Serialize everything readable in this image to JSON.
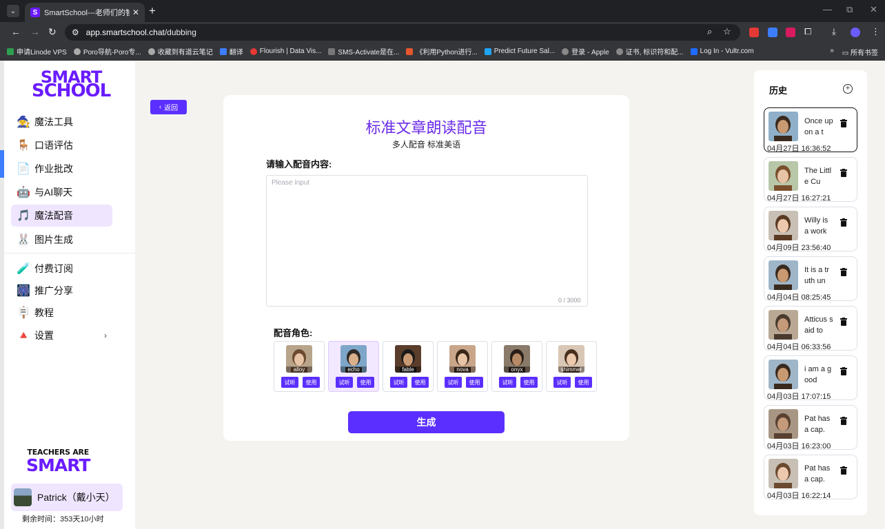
{
  "browser": {
    "tab_title": "SmartSchool---老师们的智能AI",
    "url_domain": "app.smartschool.chat",
    "url_path": "/dubbing",
    "bookmarks": [
      "申请Linode VPS",
      "Poro导航-Poro专...",
      "收藏到有道云笔记",
      "翻译",
      "Flourish | Data Vis...",
      "SMS-Activate是在...",
      "《利用Python进行...",
      "Predict Future Sal...",
      "登录 - Apple",
      "证书, 标识符和配...",
      "Log In - Vultr.com"
    ],
    "all_bookmarks": "所有书签"
  },
  "sidebar": {
    "logo_line1": "SMART",
    "logo_line2": "SCHOOL",
    "items": [
      {
        "label": "魔法工具",
        "icon": "🧙"
      },
      {
        "label": "口语评估",
        "icon": "🪑"
      },
      {
        "label": "作业批改",
        "icon": "📄"
      },
      {
        "label": "与AI聊天",
        "icon": "🤖"
      },
      {
        "label": "魔法配音",
        "icon": "🎵"
      },
      {
        "label": "图片生成",
        "icon": "🐰"
      },
      {
        "label": "付费订阅",
        "icon": "🧪"
      },
      {
        "label": "推广分享",
        "icon": "🎆"
      },
      {
        "label": "教程",
        "icon": "🪧"
      },
      {
        "label": "设置",
        "icon": "🔺"
      }
    ],
    "teachers_line1": "TEACHERS ARE",
    "teachers_line2": "SMART",
    "user_name": "Patrick（戴小天）",
    "remaining": "剩余时间：353天10小时"
  },
  "main": {
    "back_label": "返回",
    "title": "标准文章朗读配音",
    "subtitle": "多人配音 标准美语",
    "input_label": "请输入配音内容:",
    "input_placeholder": "Please input",
    "input_value": "",
    "counter": "0 / 3000",
    "role_label": "配音角色:",
    "listen_label": "试听",
    "use_label": "使用",
    "voices": [
      "alloy",
      "echo",
      "fable",
      "nova",
      "onyx",
      "shimmer"
    ],
    "generate_label": "生成"
  },
  "history": {
    "title": "历史",
    "items": [
      {
        "text": "Once upon a t",
        "date": "04月27日 16:36:52"
      },
      {
        "text": "The Little Cu",
        "date": "04月27日 16:27:21"
      },
      {
        "text": "Willy is a work",
        "date": "04月09日 23:56:40"
      },
      {
        "text": "It is a truth un",
        "date": "04月04日 08:25:45"
      },
      {
        "text": "Atticus said to",
        "date": "04月04日 06:33:56"
      },
      {
        "text": "i am a good",
        "date": "04月03日 17:07:15"
      },
      {
        "text": "Pat has a cap.",
        "date": "04月03日 16:23:00"
      },
      {
        "text": "Pat has a cap.",
        "date": "04月03日 16:22:14"
      }
    ]
  }
}
